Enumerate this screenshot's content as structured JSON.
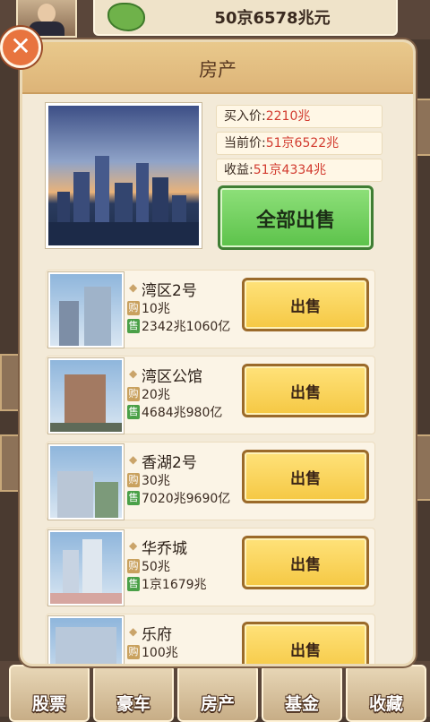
{
  "top": {
    "money": "50京6578兆元"
  },
  "modal": {
    "title": "房产",
    "close_glyph": "✕",
    "summary": {
      "buy_label": "买入价:",
      "buy_value": "2210兆",
      "current_label": "当前价:",
      "current_value": "51京6522兆",
      "profit_label": "收益:",
      "profit_value": "51京4334兆",
      "sell_all_label": "全部出售"
    },
    "tag_buy": "购",
    "tag_sell": "售",
    "sell_label": "出售",
    "items": [
      {
        "name": "湾区2号",
        "buy": "10兆",
        "sell": "2342兆1060亿"
      },
      {
        "name": "湾区公馆",
        "buy": "20兆",
        "sell": "4684兆980亿"
      },
      {
        "name": "香湖2号",
        "buy": "30兆",
        "sell": "7020兆9690亿"
      },
      {
        "name": "华乔城",
        "buy": "50兆",
        "sell": "1京1679兆"
      },
      {
        "name": "乐府",
        "buy": "100兆",
        "sell": ""
      }
    ]
  },
  "nav": [
    {
      "label": "股票"
    },
    {
      "label": "豪车"
    },
    {
      "label": "房产"
    },
    {
      "label": "基金"
    },
    {
      "label": "收藏"
    }
  ],
  "colors": {
    "sell_all": "#5cc24a",
    "sell": "#f5c843",
    "value_red": "#d23a2e",
    "header": "#ddb478"
  }
}
